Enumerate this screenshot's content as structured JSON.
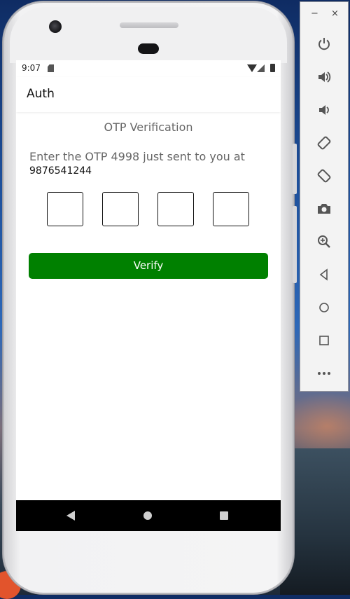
{
  "status_bar": {
    "time": "9:07"
  },
  "app_bar": {
    "title": "Auth"
  },
  "otp": {
    "heading": "OTP Verification",
    "instruction": "Enter the OTP 4998 just sent to you at",
    "phone_number": "9876541244",
    "boxes": [
      "",
      "",
      "",
      ""
    ]
  },
  "actions": {
    "verify_label": "Verify"
  },
  "colors": {
    "verify_button": "#008000",
    "navbar": "#000000"
  },
  "emulator_toolbar": {
    "minimize": "−",
    "close": "×",
    "items": [
      "power-icon",
      "volume-up-icon",
      "volume-down-icon",
      "rotate-left-icon",
      "rotate-right-icon",
      "camera-icon",
      "zoom-icon",
      "back-icon",
      "home-icon",
      "overview-icon",
      "more-icon"
    ]
  }
}
